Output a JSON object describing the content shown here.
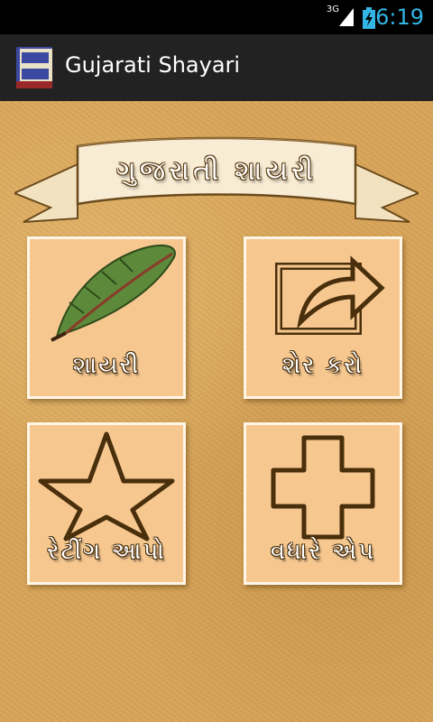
{
  "status_bar": {
    "network": "3G",
    "time": "6:19"
  },
  "action_bar": {
    "title": "Gujarati Shayari",
    "icon": "gujarati-shayari-book-icon"
  },
  "banner": {
    "text": "ગુજરાતી શાયરી"
  },
  "menu": {
    "items": [
      {
        "label": "શાયરી",
        "icon": "feather-pen-icon"
      },
      {
        "label": "શેર કરો",
        "icon": "share-icon"
      },
      {
        "label": "રેટીંગ આપો",
        "icon": "star-icon"
      },
      {
        "label": "વધારે એપ",
        "icon": "plus-icon"
      }
    ]
  },
  "colors": {
    "status_accent": "#33b5e5",
    "action_bar": "#222222",
    "background": "#d8a55a",
    "tile": "#f6c890"
  }
}
